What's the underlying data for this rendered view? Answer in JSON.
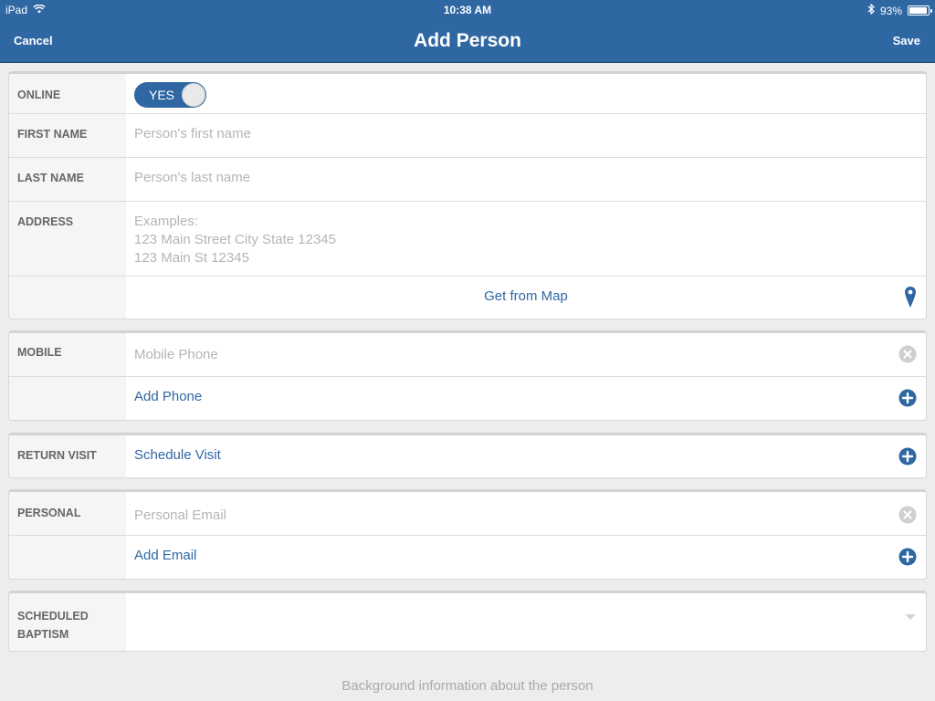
{
  "status": {
    "device": "iPad",
    "time": "10:38 AM",
    "battery": "93%",
    "battery_level": 0.93
  },
  "nav": {
    "cancel": "Cancel",
    "title": "Add Person",
    "save": "Save"
  },
  "fields": {
    "online_label": "ONLINE",
    "online_toggle": "YES",
    "first_name_label": "FIRST NAME",
    "first_name_placeholder": "Person's first name",
    "last_name_label": "LAST NAME",
    "last_name_placeholder": "Person's last name",
    "address_label": "ADDRESS",
    "address_placeholder_1": "Examples:",
    "address_placeholder_2": "123 Main Street City State 12345",
    "address_placeholder_3": "123 Main St 12345",
    "get_from_map": "Get from Map",
    "mobile_label": "MOBILE",
    "mobile_placeholder": "Mobile Phone",
    "add_phone": "Add Phone",
    "return_visit_label": "RETURN VISIT",
    "schedule_visit": "Schedule Visit",
    "personal_label": "PERSONAL",
    "personal_placeholder": "Personal Email",
    "add_email": "Add Email",
    "scheduled_baptism_label_1": "SCHEDULED",
    "scheduled_baptism_label_2": "BAPTISM"
  },
  "footer": {
    "background_info": "Background information about the person"
  },
  "colors": {
    "accent": "#2f67a3",
    "placeholder": "#b5b5b5",
    "label": "#666666"
  },
  "icons": [
    "wifi-icon",
    "bluetooth-icon",
    "battery-icon",
    "map-pin-icon",
    "clear-icon",
    "add-icon",
    "dropdown-arrow-icon"
  ]
}
